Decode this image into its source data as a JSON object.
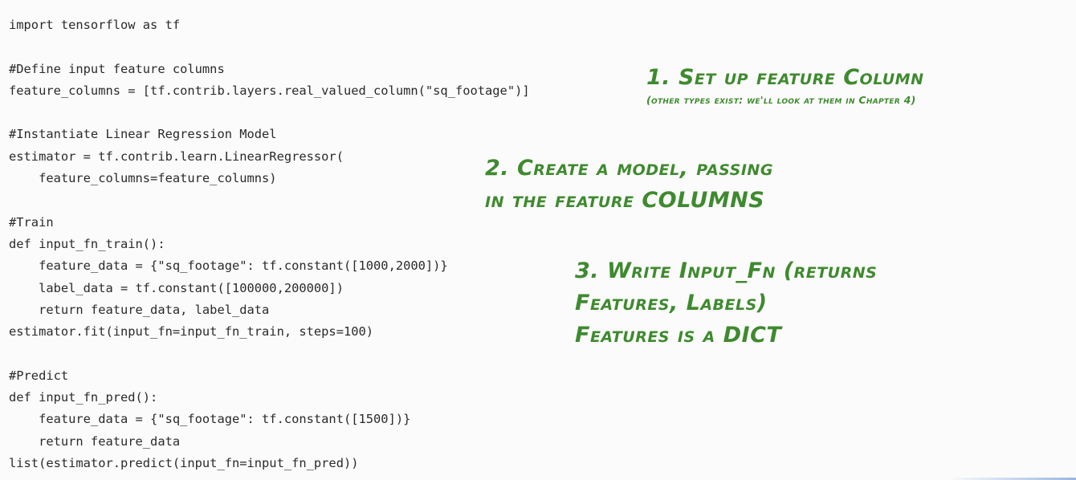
{
  "code_lines": [
    "import tensorflow as tf",
    "",
    "#Define input feature columns",
    "feature_columns = [tf.contrib.layers.real_valued_column(\"sq_footage\")]",
    "",
    "#Instantiate Linear Regression Model",
    "estimator = tf.contrib.learn.LinearRegressor(",
    "    feature_columns=feature_columns)",
    "",
    "#Train",
    "def input_fn_train():",
    "    feature_data = {\"sq_footage\": tf.constant([1000,2000])}",
    "    label_data = tf.constant([100000,200000])",
    "    return feature_data, label_data",
    "estimator.fit(input_fn=input_fn_train, steps=100)",
    "",
    "#Predict",
    "def input_fn_pred():",
    "    feature_data = {\"sq_footage\": tf.constant([1500])}",
    "    return feature_data",
    "list(estimator.predict(input_fn=input_fn_pred))"
  ],
  "annotations": {
    "note1": {
      "title": "1. Set up feature Column",
      "subtitle": "(other types exist: we'll look at them in Chapter 4)"
    },
    "note2": {
      "line1": "2. Create a model, passing",
      "line2": "in the feature COLUMNS"
    },
    "note3": {
      "line1": "3. Write Input_Fn (returns",
      "line2": "Features, Labels)",
      "line3": "Features is a DICT"
    }
  },
  "colors": {
    "background": "#fbfbfb",
    "code_text": "#2a2a2a",
    "annotation": "#3f8a2f"
  }
}
